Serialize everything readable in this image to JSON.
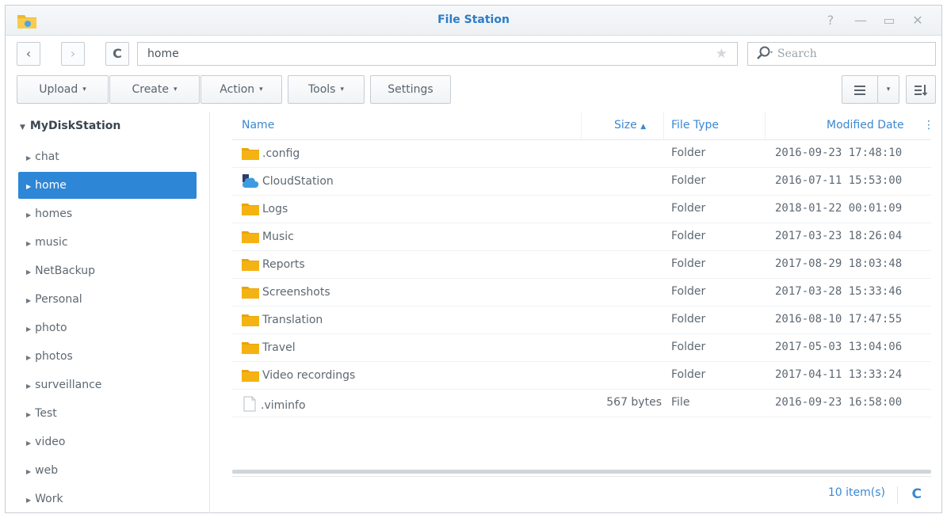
{
  "window": {
    "title": "File Station",
    "help_label": "?",
    "minimize_label": "—",
    "maximize_label": "▭",
    "close_label": "✕"
  },
  "nav": {
    "back_label": "‹",
    "forward_label": "›",
    "refresh_label": "C",
    "path": "home",
    "favorite_label": "★",
    "search_placeholder": "Search"
  },
  "toolbar": {
    "upload": "Upload",
    "create": "Create",
    "action": "Action",
    "tools": "Tools",
    "settings": "Settings",
    "caret": "▾"
  },
  "sidebar": {
    "root_arrow": "▼",
    "root": "MyDiskStation",
    "arrow": "▶",
    "items": [
      {
        "label": "chat"
      },
      {
        "label": "home"
      },
      {
        "label": "homes"
      },
      {
        "label": "music"
      },
      {
        "label": "NetBackup"
      },
      {
        "label": "Personal"
      },
      {
        "label": "photo"
      },
      {
        "label": "photos"
      },
      {
        "label": "surveillance"
      },
      {
        "label": "Test"
      },
      {
        "label": "video"
      },
      {
        "label": "web"
      },
      {
        "label": "Work"
      }
    ],
    "selected": "home"
  },
  "grid": {
    "columns": {
      "name": "Name",
      "size": "Size",
      "size_sort": "▲",
      "type": "File Type",
      "date": "Modified Date"
    },
    "rows": [
      {
        "name": ".config",
        "size": "",
        "type": "Folder",
        "date": "2016-09-23 17:48:10",
        "icon": "folder"
      },
      {
        "name": "CloudStation",
        "size": "",
        "type": "Folder",
        "date": "2016-07-11 15:53:00",
        "icon": "cloudstation"
      },
      {
        "name": "Logs",
        "size": "",
        "type": "Folder",
        "date": "2018-01-22 00:01:09",
        "icon": "folder"
      },
      {
        "name": "Music",
        "size": "",
        "type": "Folder",
        "date": "2017-03-23 18:26:04",
        "icon": "folder"
      },
      {
        "name": "Reports",
        "size": "",
        "type": "Folder",
        "date": "2017-08-29 18:03:48",
        "icon": "folder"
      },
      {
        "name": "Screenshots",
        "size": "",
        "type": "Folder",
        "date": "2017-03-28 15:33:46",
        "icon": "folder"
      },
      {
        "name": "Translation",
        "size": "",
        "type": "Folder",
        "date": "2016-08-10 17:47:55",
        "icon": "folder"
      },
      {
        "name": "Travel",
        "size": "",
        "type": "Folder",
        "date": "2017-05-03 13:04:06",
        "icon": "folder"
      },
      {
        "name": "Video recordings",
        "size": "",
        "type": "Folder",
        "date": "2017-04-11 13:33:24",
        "icon": "folder"
      },
      {
        "name": ".viminfo",
        "size": "567 bytes",
        "type": "File",
        "date": "2016-09-23 16:58:00",
        "icon": "file"
      }
    ]
  },
  "footer": {
    "item_count": "10 item(s)"
  },
  "colors": {
    "accent": "#2e86d6",
    "link": "#3b88d1",
    "folder": "#f5b313"
  }
}
